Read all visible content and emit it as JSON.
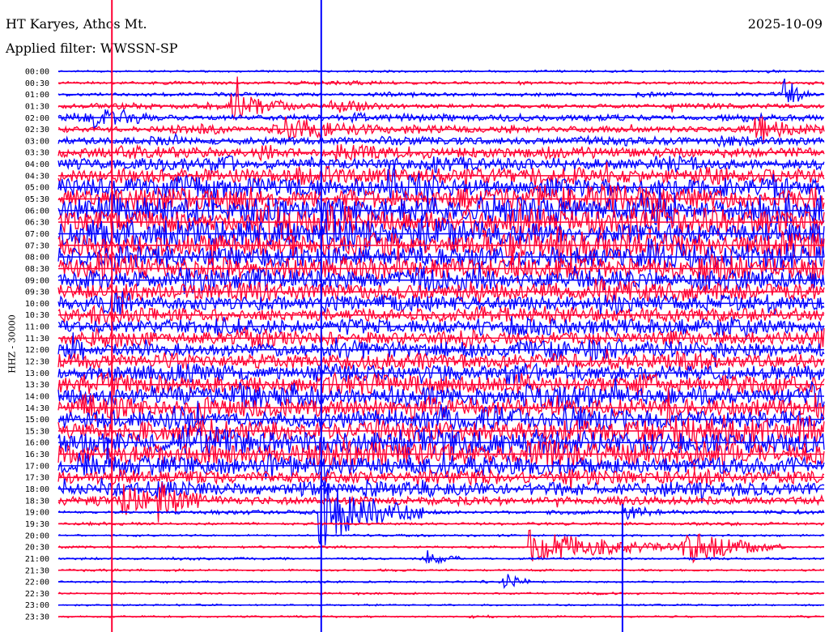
{
  "header": {
    "station": "HT Karyes, Athos Mt.",
    "date": "2025-10-09",
    "filter": "Applied filter: WWSSN-SP"
  },
  "chart_data": {
    "type": "line",
    "subtype": "helicorder",
    "ylabel": "HHZ - 30000",
    "row_minutes": 30,
    "colors": {
      "even_row": "#0000ff",
      "odd_row": "#ff0033"
    },
    "row_labels": [
      "00:00",
      "00:30",
      "01:00",
      "01:30",
      "02:00",
      "02:30",
      "03:00",
      "03:30",
      "04:00",
      "04:30",
      "05:00",
      "05:30",
      "06:00",
      "06:30",
      "07:00",
      "07:30",
      "08:00",
      "08:30",
      "09:00",
      "09:30",
      "10:00",
      "10:30",
      "11:00",
      "11:30",
      "12:00",
      "12:30",
      "13:00",
      "13:30",
      "14:00",
      "14:30",
      "15:00",
      "15:30",
      "16:00",
      "16:30",
      "17:00",
      "17:30",
      "18:00",
      "18:30",
      "19:00",
      "19:30",
      "20:00",
      "20:30",
      "21:00",
      "21:30",
      "22:00",
      "22:30",
      "23:00",
      "23:30"
    ],
    "noise_level": [
      0.05,
      0.08,
      0.1,
      0.15,
      0.2,
      0.2,
      0.25,
      0.35,
      0.4,
      0.5,
      0.65,
      0.7,
      0.8,
      0.85,
      0.8,
      0.8,
      0.75,
      0.7,
      0.6,
      0.55,
      0.5,
      0.5,
      0.45,
      0.45,
      0.5,
      0.55,
      0.55,
      0.6,
      0.6,
      0.65,
      0.65,
      0.7,
      0.75,
      0.75,
      0.6,
      0.45,
      0.4,
      0.3,
      0.1,
      0.08,
      0.05,
      0.06,
      0.05,
      0.05,
      0.04,
      0.04,
      0.04,
      0.04
    ],
    "events": [
      {
        "row": 3,
        "minute": 6.8,
        "amp": 1.0,
        "dur": 1.5
      },
      {
        "row": 3,
        "minute": 10.7,
        "amp": 0.6,
        "dur": 1.2
      },
      {
        "row": 4,
        "minute": 1.5,
        "amp": 0.8,
        "dur": 1.0
      },
      {
        "row": 5,
        "minute": 9.0,
        "amp": 0.8,
        "dur": 2.0
      },
      {
        "row": 5,
        "minute": 27.3,
        "amp": 1.0,
        "dur": 1.5
      },
      {
        "row": 2,
        "minute": 28.5,
        "amp": 1.5,
        "dur": 0.5
      },
      {
        "row": 10,
        "minute": 13.0,
        "amp": 2.0,
        "dur": 1.0
      },
      {
        "row": 37,
        "minute": 2.5,
        "amp": 1.2,
        "dur": 1.2
      },
      {
        "row": 37,
        "minute": 4.0,
        "amp": 1.2,
        "dur": 1.2
      },
      {
        "row": 38,
        "minute": 10.3,
        "amp": 3.0,
        "dur": 2.0
      },
      {
        "row": 38,
        "minute": 22.2,
        "amp": 0.5,
        "dur": 1.0
      },
      {
        "row": 41,
        "minute": 18.5,
        "amp": 1.5,
        "dur": 3.0
      },
      {
        "row": 41,
        "minute": 24.5,
        "amp": 1.5,
        "dur": 2.0
      },
      {
        "row": 42,
        "minute": 14.5,
        "amp": 0.6,
        "dur": 0.6
      },
      {
        "row": 44,
        "minute": 17.5,
        "amp": 0.8,
        "dur": 0.5
      }
    ],
    "spikes": [
      {
        "minute": 2.1,
        "from_label": "00:00",
        "to_label": "23:30",
        "color": "#ff0033"
      },
      {
        "minute": 10.3,
        "from_label": "00:00",
        "to_label": "23:30",
        "color": "#0000ff"
      },
      {
        "minute": 22.1,
        "from_label": "19:00",
        "to_label": "23:30",
        "color": "#0000ff"
      }
    ]
  }
}
